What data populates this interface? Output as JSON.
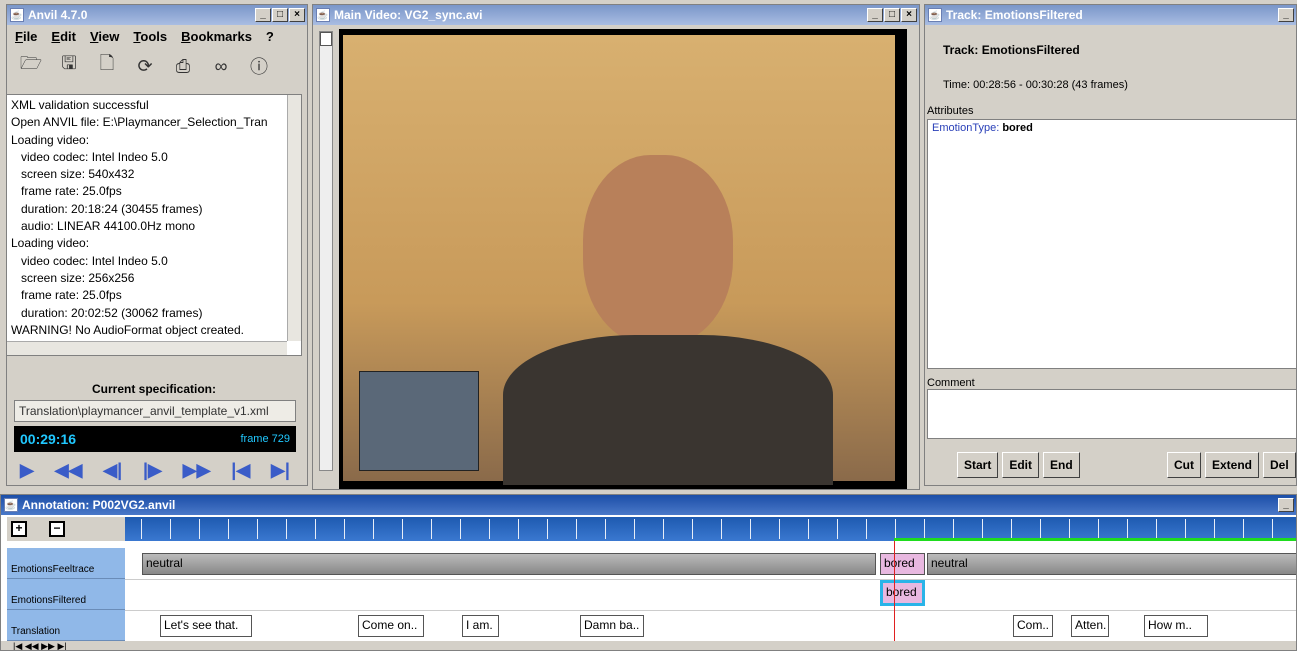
{
  "anvil": {
    "title": "Anvil 4.7.0",
    "menu": [
      "File",
      "Edit",
      "View",
      "Tools",
      "Bookmarks",
      "?"
    ],
    "toolbar_icons": [
      "open-folder-icon",
      "save-icon",
      "new-document-icon",
      "refresh-icon",
      "print-icon",
      "binoculars-icon",
      "info-icon"
    ],
    "log_lines": [
      "XML validation successful",
      "Open ANVIL file: E:\\Playmancer_Selection_Tran",
      "Loading video:",
      "   video codec: Intel Indeo 5.0",
      "   screen size: 540x432",
      "   frame rate: 25.0fps",
      "   duration: 20:18:24 (30455 frames)",
      "   audio: LINEAR 44100.0Hz mono",
      "Loading video:",
      "   video codec: Intel Indeo 5.0",
      "   screen size: 256x256",
      "   frame rate: 25.0fps",
      "   duration: 20:02:52 (30062 frames)",
      "WARNING! No AudioFormat object created."
    ],
    "spec_label": "Current specification:",
    "spec_value": "Translation\\playmancer_anvil_template_v1.xml",
    "time": "00:29:16",
    "frame": "frame 729"
  },
  "video": {
    "title": "Main Video: VG2_sync.avi"
  },
  "track": {
    "title": "Track: EmotionsFiltered",
    "heading": "Track: EmotionsFiltered",
    "time": "Time: 00:28:56 - 00:30:28 (43 frames)",
    "attributes_label": "Attributes",
    "attr_key": "EmotionType:",
    "attr_value": "bored",
    "comment_label": "Comment",
    "buttons": [
      "Start",
      "Edit",
      "End",
      "Cut",
      "Extend",
      "Del"
    ]
  },
  "annotation": {
    "title": "Annotation: P002VG2.anvil",
    "zoom_in": "+",
    "zoom_out": "−",
    "tracks": [
      {
        "name": "EmotionsFeeltrace",
        "segments": [
          {
            "label": "neutral"
          },
          {
            "label": "bored"
          },
          {
            "label": "neutral"
          }
        ]
      },
      {
        "name": "EmotionsFiltered",
        "segments": [
          {
            "label": "bored"
          }
        ]
      },
      {
        "name": "Translation",
        "segments": [
          {
            "label": "Let's see that."
          },
          {
            "label": "Come on.."
          },
          {
            "label": "I am."
          },
          {
            "label": "Damn ba.."
          },
          {
            "label": "Com.."
          },
          {
            "label": "Atten."
          },
          {
            "label": "How m.."
          }
        ]
      }
    ]
  },
  "colors": {
    "timecode": "#20c8ff",
    "selection": "#2ab4e8",
    "bored": "#e8b8e0",
    "neutral_bar": "#808080"
  }
}
